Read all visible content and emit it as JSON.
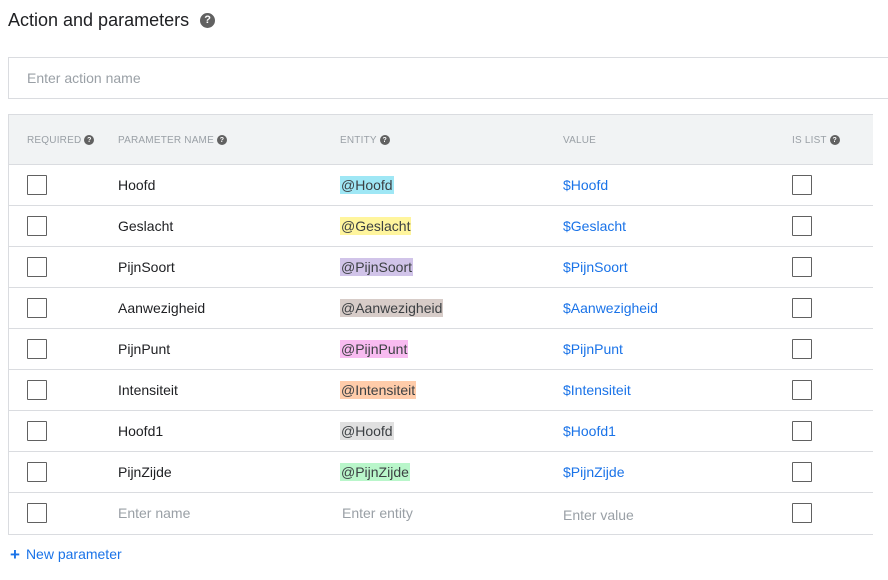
{
  "header": {
    "title": "Action and parameters",
    "help_icon": "question-circle-icon"
  },
  "action": {
    "placeholder": "Enter action name",
    "value": ""
  },
  "table": {
    "columns": {
      "required": "REQUIRED",
      "parameter_name": "PARAMETER NAME",
      "entity": "ENTITY",
      "value": "VALUE",
      "is_list": "IS LIST"
    },
    "rows": [
      {
        "name": "Hoofd",
        "entity": "@Hoofd",
        "entity_color": "#9fe7f5",
        "value": "$Hoofd",
        "required": false,
        "is_list": false
      },
      {
        "name": "Geslacht",
        "entity": "@Geslacht",
        "entity_color": "#fff59d",
        "value": "$Geslacht",
        "required": false,
        "is_list": false
      },
      {
        "name": "PijnSoort",
        "entity": "@PijnSoort",
        "entity_color": "#d1c4e9",
        "value": "$PijnSoort",
        "required": false,
        "is_list": false
      },
      {
        "name": "Aanwezigheid",
        "entity": "@Aanwezigheid",
        "entity_color": "#d7ccc8",
        "value": "$Aanwezigheid",
        "required": false,
        "is_list": false
      },
      {
        "name": "PijnPunt",
        "entity": "@PijnPunt",
        "entity_color": "#f8bbf0",
        "value": "$PijnPunt",
        "required": false,
        "is_list": false
      },
      {
        "name": "Intensiteit",
        "entity": "@Intensiteit",
        "entity_color": "#ffccaa",
        "value": "$Intensiteit",
        "required": false,
        "is_list": false
      },
      {
        "name": "Hoofd1",
        "entity": "@Hoofd",
        "entity_color": "#e0e0e0",
        "value": "$Hoofd1",
        "required": false,
        "is_list": false
      },
      {
        "name": "PijnZijde",
        "entity": "@PijnZijde",
        "entity_color": "#b9f6ca",
        "value": "$PijnZijde",
        "required": false,
        "is_list": false
      }
    ],
    "new_row": {
      "name_placeholder": "Enter name",
      "entity_placeholder": "Enter entity",
      "value_placeholder": "Enter value"
    }
  },
  "new_parameter": {
    "label": "New parameter",
    "icon": "plus-icon"
  },
  "colors": {
    "link": "#1a73e8",
    "header_bg": "#f1f3f4",
    "border": "#dadce0"
  }
}
